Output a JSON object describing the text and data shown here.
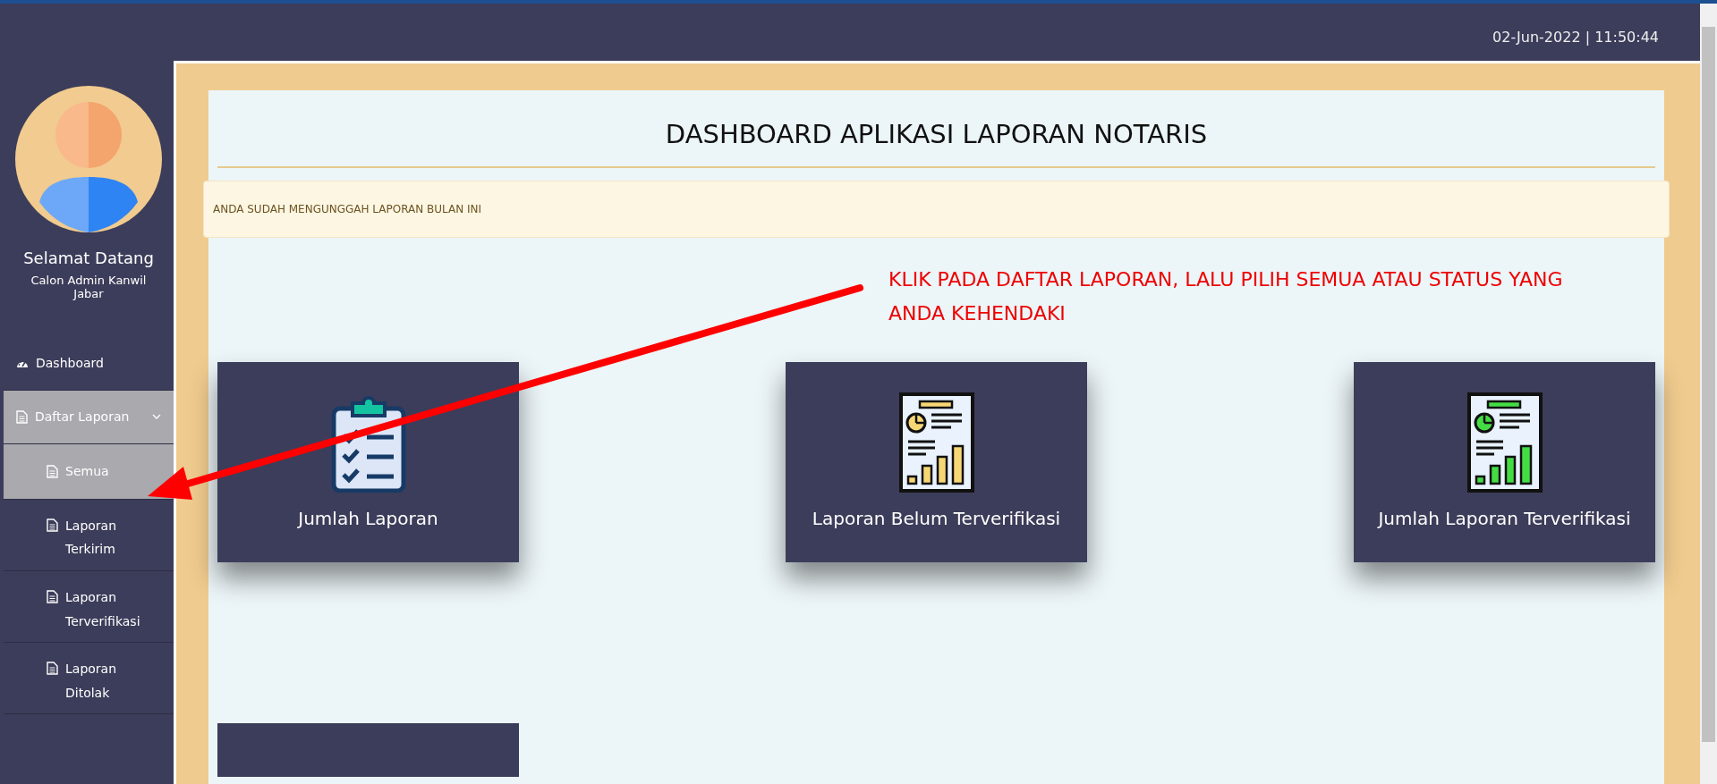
{
  "header": {
    "datetime": "02-Jun-2022 | 11:50:44"
  },
  "sidebar": {
    "greeting": "Selamat Datang",
    "user": "Calon Admin Kanwil Jabar",
    "items": [
      {
        "label": "Dashboard",
        "kind": "dashboard",
        "selected": false
      },
      {
        "label": "Daftar Laporan",
        "kind": "document",
        "selected": true,
        "expanded": true,
        "children": [
          {
            "label": "Semua",
            "selected": true
          },
          {
            "label": "Laporan Terkirim",
            "selected": false
          },
          {
            "label": "Laporan Terverifikasi",
            "selected": false
          },
          {
            "label": "Laporan Ditolak",
            "selected": false
          }
        ]
      }
    ]
  },
  "main": {
    "title": "DASHBOARD APLIKASI LAPORAN NOTARIS",
    "alert": "ANDA SUDAH MENGUNGGAH LAPORAN BULAN INI",
    "annotation": "KLIK PADA DAFTAR LAPORAN, LALU PILIH SEMUA ATAU STATUS YANG ANDA KEHENDAKI",
    "cards": [
      {
        "label": "Jumlah Laporan",
        "kind": "clipboard"
      },
      {
        "label": "Laporan Belum Terverifikasi",
        "kind": "report",
        "color": "#f7d774"
      },
      {
        "label": "Jumlah Laporan Terverifikasi",
        "kind": "report",
        "color": "#44dd44"
      },
      {
        "kind": "cut-off"
      }
    ]
  }
}
